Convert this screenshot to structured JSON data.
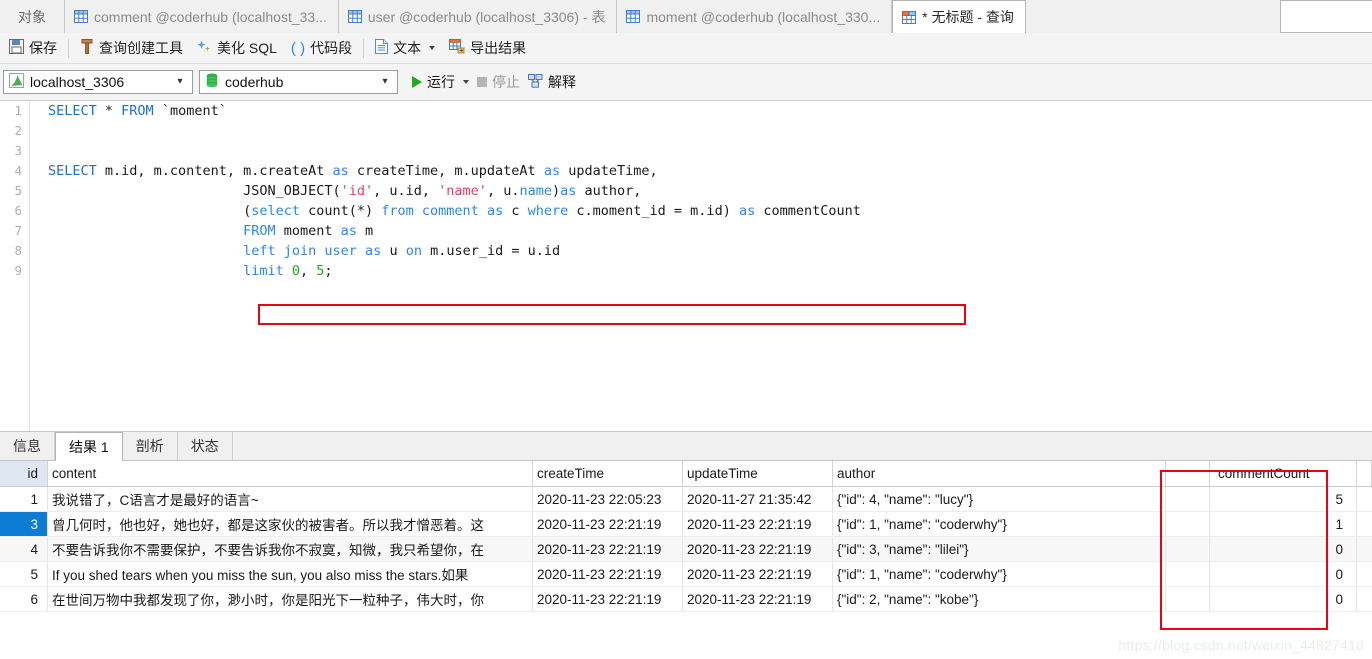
{
  "window": {
    "objects_label": "对象"
  },
  "tabs": [
    {
      "label": "comment @coderhub (localhost_33...",
      "icon": "table-grid-icon",
      "active": false
    },
    {
      "label": "user @coderhub (localhost_3306) - 表",
      "icon": "table-grid-icon",
      "active": false
    },
    {
      "label": "moment @coderhub (localhost_330...",
      "icon": "table-grid-icon",
      "active": false
    },
    {
      "label": "* 无标题 - 查询",
      "icon": "query-grid-icon",
      "active": true
    }
  ],
  "toolbar": {
    "save": "保存",
    "query_builder": "查询创建工具",
    "beautify_sql": "美化 SQL",
    "code_snippet": "代码段",
    "text": "文本",
    "export_result": "导出结果"
  },
  "connection_bar": {
    "connection": "localhost_3306",
    "database": "coderhub",
    "run": "运行",
    "stop": "停止",
    "explain": "解释"
  },
  "editor": {
    "line_numbers": [
      "1",
      "2",
      "3",
      "4",
      "5",
      "6",
      "7",
      "8",
      "9"
    ],
    "lines": [
      [
        {
          "t": "SELECT",
          "c": "kw"
        },
        {
          "t": " * ",
          "c": "plain"
        },
        {
          "t": "FROM",
          "c": "kw"
        },
        {
          "t": " `moment`",
          "c": "plain"
        }
      ],
      [],
      [],
      [
        {
          "t": "SELECT",
          "c": "kw"
        },
        {
          "t": " m.id, m.content, m.createAt ",
          "c": "plain"
        },
        {
          "t": "as",
          "c": "kw2"
        },
        {
          "t": " createTime, m.updateAt ",
          "c": "plain"
        },
        {
          "t": "as",
          "c": "kw2"
        },
        {
          "t": " updateTime,",
          "c": "plain"
        }
      ],
      [
        {
          "t": "                        JSON_OBJECT(",
          "c": "plain"
        },
        {
          "t": "'id'",
          "c": "str"
        },
        {
          "t": ", u.id, ",
          "c": "plain"
        },
        {
          "t": "'name'",
          "c": "str"
        },
        {
          "t": ", u.",
          "c": "plain"
        },
        {
          "t": "name",
          "c": "kw2"
        },
        {
          "t": ")",
          "c": "plain"
        },
        {
          "t": "as",
          "c": "kw2"
        },
        {
          "t": " author,",
          "c": "plain"
        }
      ],
      [
        {
          "t": "                        (",
          "c": "plain"
        },
        {
          "t": "select",
          "c": "kw2"
        },
        {
          "t": " count(*) ",
          "c": "plain"
        },
        {
          "t": "from",
          "c": "kw2"
        },
        {
          "t": " ",
          "c": "plain"
        },
        {
          "t": "comment",
          "c": "kw2"
        },
        {
          "t": " ",
          "c": "plain"
        },
        {
          "t": "as",
          "c": "kw2"
        },
        {
          "t": " c ",
          "c": "plain"
        },
        {
          "t": "where",
          "c": "kw2"
        },
        {
          "t": " c.moment_id = m.id) ",
          "c": "plain"
        },
        {
          "t": "as",
          "c": "kw2"
        },
        {
          "t": " commentCount",
          "c": "plain"
        }
      ],
      [
        {
          "t": "                        ",
          "c": "plain"
        },
        {
          "t": "FROM",
          "c": "kw2"
        },
        {
          "t": " moment ",
          "c": "plain"
        },
        {
          "t": "as",
          "c": "kw2"
        },
        {
          "t": " m",
          "c": "plain"
        }
      ],
      [
        {
          "t": "                        ",
          "c": "plain"
        },
        {
          "t": "left",
          "c": "kw2"
        },
        {
          "t": " ",
          "c": "plain"
        },
        {
          "t": "join",
          "c": "kw2"
        },
        {
          "t": " ",
          "c": "plain"
        },
        {
          "t": "user",
          "c": "kw2"
        },
        {
          "t": " ",
          "c": "plain"
        },
        {
          "t": "as",
          "c": "kw2"
        },
        {
          "t": " u ",
          "c": "plain"
        },
        {
          "t": "on",
          "c": "kw2"
        },
        {
          "t": " m.user_id = u.id",
          "c": "plain"
        }
      ],
      [
        {
          "t": "                        ",
          "c": "plain"
        },
        {
          "t": "limit",
          "c": "kw2"
        },
        {
          "t": " ",
          "c": "plain"
        },
        {
          "t": "0",
          "c": "num"
        },
        {
          "t": ", ",
          "c": "plain"
        },
        {
          "t": "5",
          "c": "num"
        },
        {
          "t": ";",
          "c": "plain"
        }
      ]
    ]
  },
  "result_tabs": [
    {
      "label": "信息",
      "active": false
    },
    {
      "label": "结果 1",
      "active": true
    },
    {
      "label": "剖析",
      "active": false
    },
    {
      "label": "状态",
      "active": false
    }
  ],
  "grid": {
    "columns": [
      "id",
      "content",
      "createTime",
      "updateTime",
      "author",
      "",
      "commentCount"
    ],
    "rows": [
      {
        "id": "1",
        "content": "我说错了，C语言才是最好的语言~",
        "createTime": "2020-11-23 22:05:23",
        "updateTime": "2020-11-27 21:35:42",
        "author": "{\"id\": 4, \"name\": \"lucy\"}",
        "commentCount": "5",
        "selected": false,
        "alt": false
      },
      {
        "id": "3",
        "content": "曾几何时，他也好，她也好，都是这家伙的被害者。所以我才憎恶着。这",
        "createTime": "2020-11-23 22:21:19",
        "updateTime": "2020-11-23 22:21:19",
        "author": "{\"id\": 1, \"name\": \"coderwhy\"}",
        "commentCount": "1",
        "selected": true,
        "alt": false
      },
      {
        "id": "4",
        "content": "不要告诉我你不需要保护，不要告诉我你不寂寞，知微，我只希望你，在",
        "createTime": "2020-11-23 22:21:19",
        "updateTime": "2020-11-23 22:21:19",
        "author": "{\"id\": 3, \"name\": \"lilei\"}",
        "commentCount": "0",
        "selected": false,
        "alt": true
      },
      {
        "id": "5",
        "content": "If you shed tears when you miss the sun, you also miss the stars.如果",
        "createTime": "2020-11-23 22:21:19",
        "updateTime": "2020-11-23 22:21:19",
        "author": "{\"id\": 1, \"name\": \"coderwhy\"}",
        "commentCount": "0",
        "selected": false,
        "alt": false
      },
      {
        "id": "6",
        "content": "在世间万物中我都发现了你，渺小时，你是阳光下一粒种子，伟大时，你",
        "createTime": "2020-11-23 22:21:19",
        "updateTime": "2020-11-23 22:21:19",
        "author": "{\"id\": 2, \"name\": \"kobe\"}",
        "commentCount": "0",
        "selected": false,
        "alt": false
      }
    ]
  },
  "watermark": "https://blog.csdn.net/weixin_44827418",
  "colors": {
    "highlight_box": "#e30613",
    "selection": "#0c7cd5",
    "keyword": "#1a6ee0",
    "string": "#e83e5a",
    "number": "#1faa1f",
    "run_green": "#1faa1f"
  }
}
